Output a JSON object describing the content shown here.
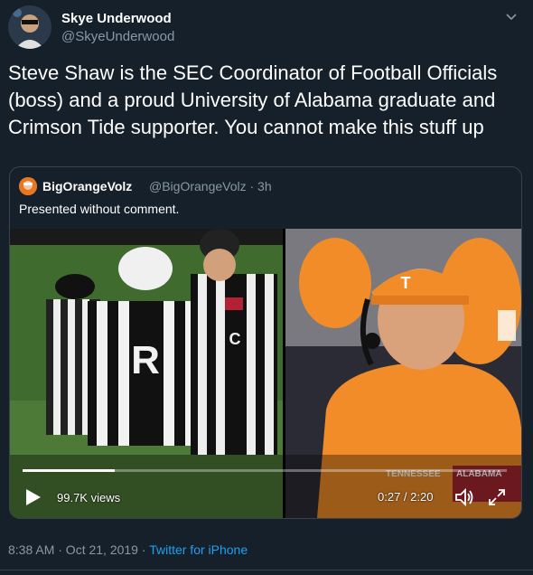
{
  "tweet": {
    "display_name": "Skye Underwood",
    "handle": "@SkyeUnderwood",
    "text": "Steve Shaw is the SEC Coordinator of Football Officials (boss) and a proud University of Alabama graduate and Crimson Tide supporter. You cannot make this stuff up",
    "timestamp": "8:38 AM · Oct 21, 2019",
    "separator": " · ",
    "source": "Twitter for iPhone"
  },
  "quoted": {
    "display_name": "BigOrangeVolz",
    "handle_time": "@BigOrangeVolz · 3h",
    "text": "Presented without comment."
  },
  "video": {
    "views": "99.7K views",
    "time": "0:27 / 2:20",
    "progress": 0.19,
    "scoreboard_home": "TENNESSEE",
    "scoreboard_away": "ALABAMA",
    "referee_letter": "R",
    "center_letter": "C",
    "cap_logo": "T"
  },
  "icons": [
    "chevron-down-icon",
    "play-icon",
    "volume-icon",
    "fullscreen-icon"
  ]
}
